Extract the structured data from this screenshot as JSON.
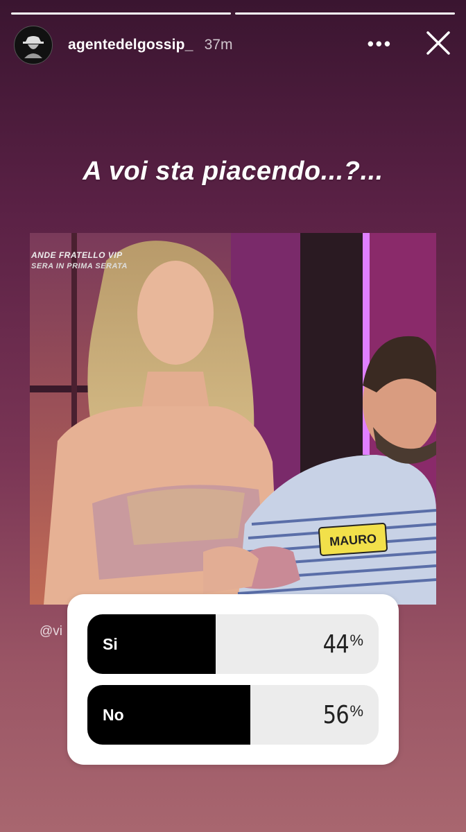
{
  "story": {
    "username": "agentedelgossip_",
    "time": "37m",
    "progress": [
      1,
      1
    ]
  },
  "question": "A voi sta piacendo...?...",
  "photo": {
    "caption_line1": "ANDE FRATELLO VIP",
    "caption_line2": "SERA IN PRIMA SERATA",
    "name_tag": "MAURO"
  },
  "mention": "@vi",
  "poll": {
    "options": [
      {
        "label": "Si",
        "percent_value": "44",
        "percent_symbol": "%",
        "fraction": 0.44
      },
      {
        "label": "No",
        "percent_value": "56",
        "percent_symbol": "%",
        "fraction": 0.56
      }
    ]
  },
  "icons": {
    "more": "more-icon",
    "close": "close-icon"
  }
}
